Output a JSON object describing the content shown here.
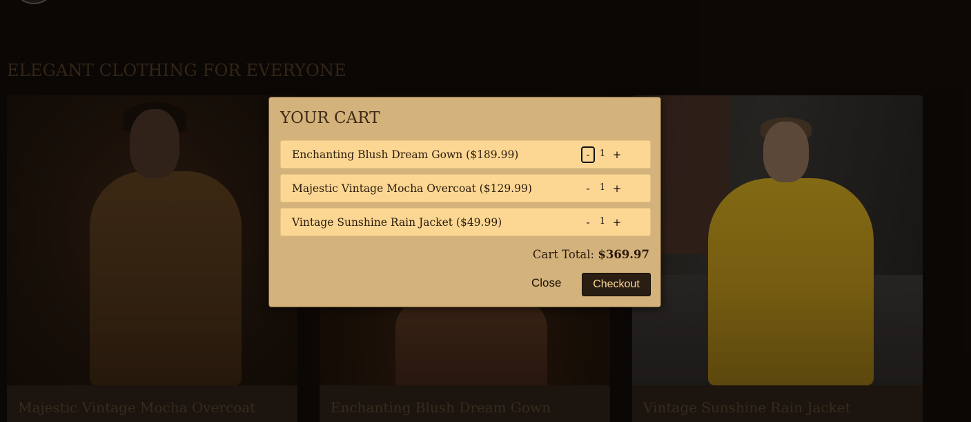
{
  "page": {
    "section_title": "ELEGANT CLOTHING FOR EVERYONE"
  },
  "products": [
    {
      "name": "Majestic Vintage Mocha Overcoat"
    },
    {
      "name": "Enchanting Blush Dream Gown"
    },
    {
      "name": "Vintage Sunshine Rain Jacket"
    }
  ],
  "cart": {
    "title": "YOUR CART",
    "items": [
      {
        "label": "Enchanting Blush Dream Gown ($189.99)",
        "minus": "-",
        "qty": "1",
        "plus": "+"
      },
      {
        "label": "Majestic Vintage Mocha Overcoat ($129.99)",
        "minus": "-",
        "qty": "1",
        "plus": "+"
      },
      {
        "label": "Vintage Sunshine Rain Jacket ($49.99)",
        "minus": "-",
        "qty": "1",
        "plus": "+"
      }
    ],
    "total_label": "Cart Total:",
    "total_amount": "$369.97",
    "close_label": "Close",
    "checkout_label": "Checkout"
  },
  "colors": {
    "background": "#120c07",
    "modal": "#d4b27b",
    "item": "#fcd793",
    "checkout": "#2a1e13"
  }
}
